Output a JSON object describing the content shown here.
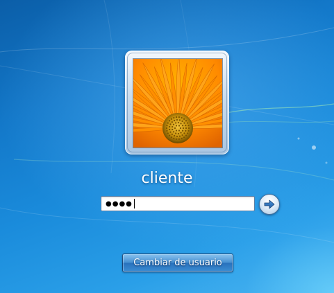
{
  "user": {
    "name": "cliente",
    "picture_icon": "orange-gerbera-flower-picture"
  },
  "password": {
    "masked_value": "●●●●"
  },
  "submit": {
    "icon": "arrow-right-icon"
  },
  "switch_user": {
    "label": "Cambiar de usuario"
  },
  "colors": {
    "background": "#1a8bdb",
    "flower_petals": "#ff8a00",
    "flower_center": "#d79a00"
  }
}
